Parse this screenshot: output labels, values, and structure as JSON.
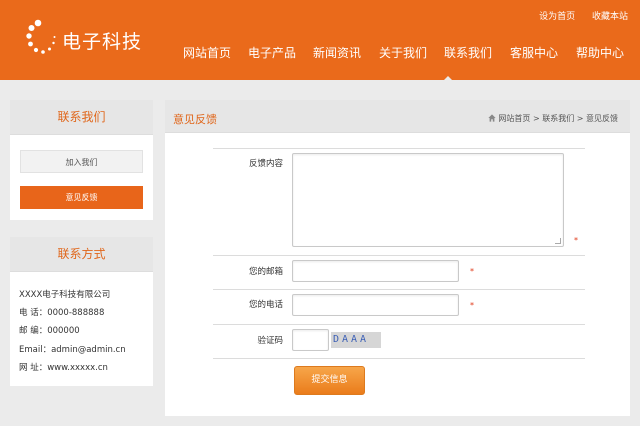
{
  "header": {
    "logo_text": "电子科技",
    "top_links": [
      "设为首页",
      "收藏本站"
    ],
    "nav": [
      "网站首页",
      "电子产品",
      "新闻资讯",
      "关于我们",
      "联系我们",
      "客服中心",
      "帮助中心"
    ],
    "active_nav": "联系我们"
  },
  "sidebar": {
    "contact_us": {
      "title": "联系我们",
      "buttons": [
        "加入我们",
        "意见反馈"
      ],
      "active_button": "意见反馈"
    },
    "contact_info": {
      "title": "联系方式",
      "lines": [
        "XXXX电子科技有限公司",
        "电 话：0000-888888",
        "邮 编：000000",
        "Email：admin@admin.cn",
        "网 址：www.xxxxx.cn"
      ]
    }
  },
  "main": {
    "title": "意见反馈",
    "breadcrumb": [
      "网站首页",
      "联系我们",
      "意见反馈"
    ],
    "breadcrumb_sep": ">",
    "form": {
      "feedback_label": "反馈内容",
      "email_label": "您的邮箱",
      "phone_label": "您的电话",
      "captcha_label": "验证码",
      "captcha_text": "DAAA",
      "required_mark": "*",
      "submit_label": "提交信息"
    }
  },
  "colors": {
    "brand_orange": "#ea6a1b",
    "accent_text": "#e0661a",
    "panel_grey": "#e6e6e6",
    "page_bg": "#ebebeb"
  },
  "icons": [
    "logo-circle-dots-icon",
    "home-icon"
  ]
}
